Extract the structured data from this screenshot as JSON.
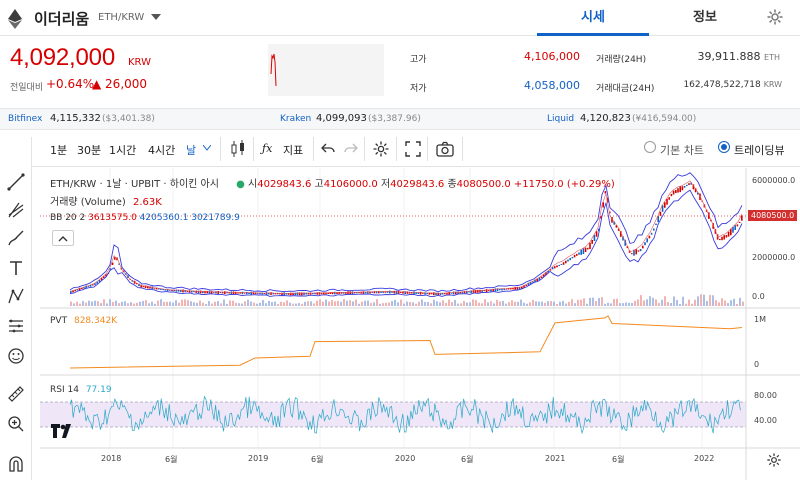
{
  "header": {
    "coin_name": "이더리움",
    "pair": "ETH/KRW",
    "tabs": [
      "시세",
      "정보"
    ]
  },
  "price": {
    "current": "4,092,000",
    "currency": "KRW",
    "change_label": "전일대비",
    "change_pct": "+0.64%",
    "change_amt": "▲ 26,000"
  },
  "stats": {
    "high_label": "고가",
    "high": "4,106,000",
    "low_label": "저가",
    "low": "4,058,000",
    "volume_label": "거래량(24H)",
    "volume": "39,911.888",
    "volume_unit": "ETH",
    "amount_label": "거래대금(24H)",
    "amount": "162,478,522,718",
    "amount_unit": "KRW"
  },
  "exchanges": [
    {
      "name": "Bitfinex",
      "price": "4,115,332",
      "usd": "($3,401.38)"
    },
    {
      "name": "Kraken",
      "price": "4,099,093",
      "usd": "($3,387.96)"
    },
    {
      "name": "Liquid",
      "price": "4,120,823",
      "usd": "(¥416,594.00)"
    }
  ],
  "toolbar": {
    "intervals": [
      "1분",
      "30분",
      "1시간",
      "4시간",
      "날"
    ],
    "indicators_label": "지표",
    "basic_chart": "기본 차트",
    "trading_view": "트레이딩뷰"
  },
  "legend": {
    "symbol": "ETH/KRW · 1날 · UPBIT · 하이킨 아시",
    "open_label": "시",
    "open": "4029843.6",
    "high_label": "고",
    "high": "4106000.0",
    "low_label": "저",
    "low": "4029843.6",
    "close_label": "종",
    "close": "4080500.0",
    "change": "+11750.0 (+0.29%)",
    "volume_label": "거래량 (Volume)",
    "volume": "2.63K",
    "bb_label": "BB 20 2",
    "bb1": "3613575.0",
    "bb2": "4205360.1",
    "bb3": "3021789.9",
    "pvt_label": "PVT",
    "pvt": "828.342K",
    "rsi_label": "RSI 14",
    "rsi": "77.19"
  },
  "axis": {
    "price_ticks": [
      "6000000.0",
      "2000000.0",
      "0.0"
    ],
    "price_tag": "4080500.0",
    "pvt_ticks": [
      "1M",
      "0"
    ],
    "rsi_ticks": [
      "80.00",
      "40.00"
    ],
    "x_ticks": [
      "2018",
      "6월",
      "2019",
      "6월",
      "2020",
      "6월",
      "2021",
      "6월",
      "2022"
    ]
  },
  "colors": {
    "up": "#d60000",
    "down": "#1261c4",
    "pvt": "#f58a1f",
    "rsi": "#2aa8c8",
    "bb": "#3a3adf"
  }
}
